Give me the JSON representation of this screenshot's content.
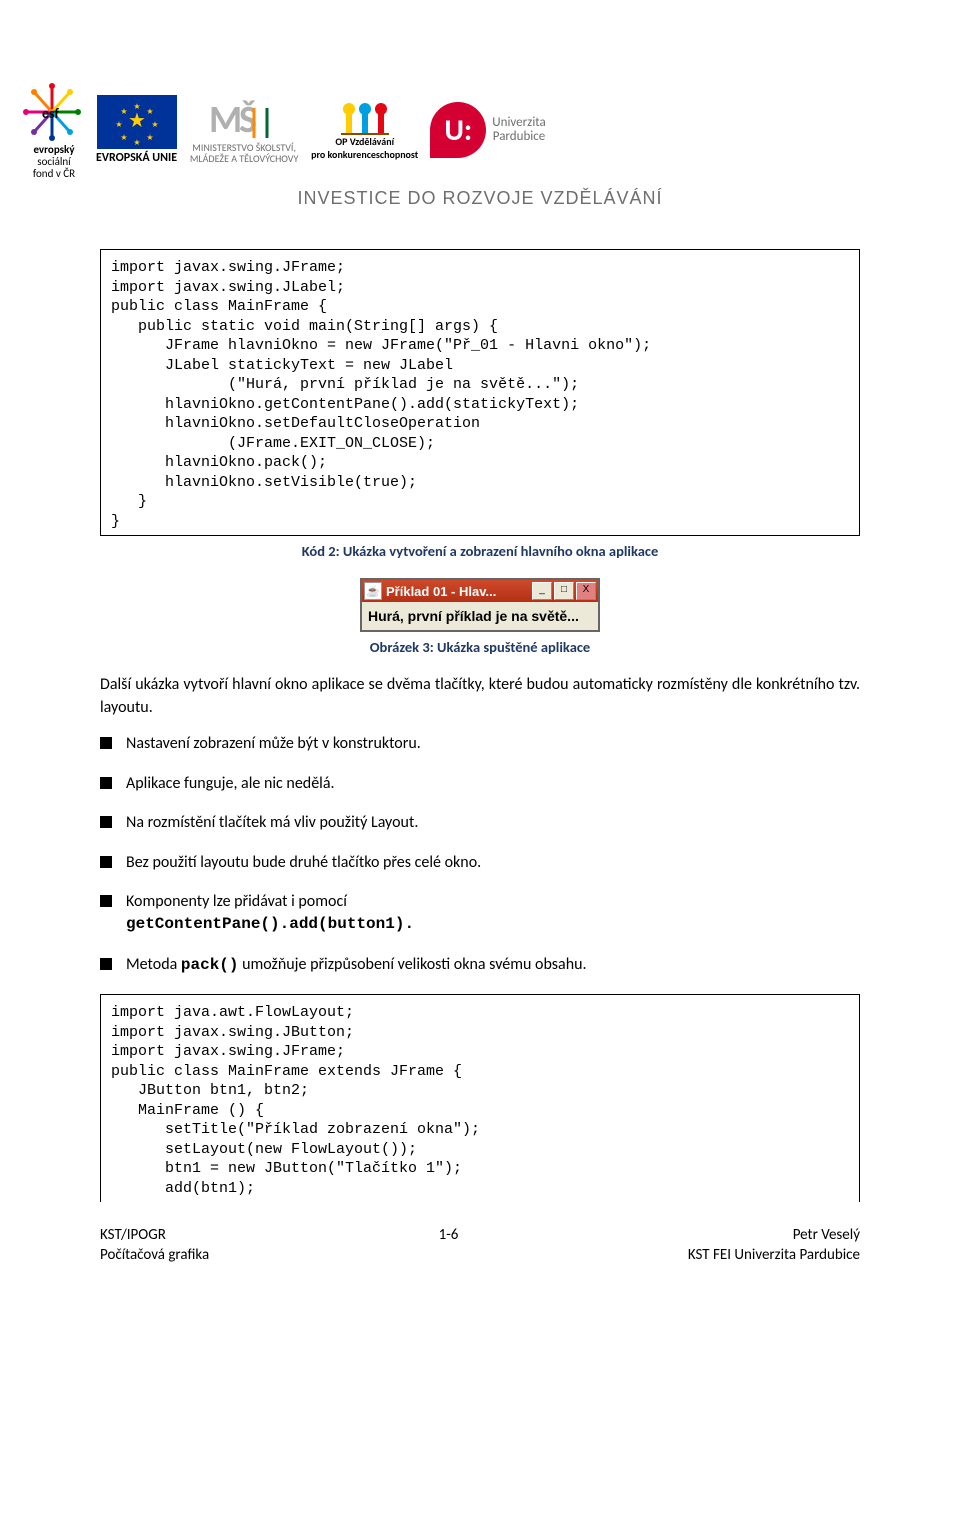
{
  "banner": {
    "esf_text1": "evropský",
    "esf_text2": "sociální",
    "esf_text3": "fond v ČR",
    "eu_label": "EVROPSKÁ UNIE",
    "msmt1": "MINISTERSTVO ŠKOLSTVÍ,",
    "msmt2": "MLÁDEŽE A TĚLOVÝCHOVY",
    "opvzd1": "OP Vzdělávání",
    "opvzd2": "pro konkurenceschopnost",
    "upce1": "Univerzita",
    "upce2": "Pardubice",
    "upce_u": "U:",
    "investice": "INVESTICE DO ROZVOJE VZDĚLÁVÁNÍ",
    "coffee": "☕"
  },
  "code1": "import javax.swing.JFrame;\nimport javax.swing.JLabel;\npublic class MainFrame {\n   public static void main(String[] args) {\n      JFrame hlavniOkno = new JFrame(\"Př_01 - Hlavni okno\");\n      JLabel statickyText = new JLabel\n             (\"Hurá, první příklad je na světě...\");\n      hlavniOkno.getContentPane().add(statickyText);\n      hlavniOkno.setDefaultCloseOperation\n             (JFrame.EXIT_ON_CLOSE);\n      hlavniOkno.pack();\n      hlavniOkno.setVisible(true);\n   }\n}",
  "caption1": "Kód 2: Ukázka vytvoření a zobrazení hlavního okna aplikace",
  "mini_window": {
    "title": "Příklad 01 - Hlav...",
    "body": "Hurá, první příklad je na světě...",
    "min": "_",
    "max": "□",
    "close": "X"
  },
  "caption2": "Obrázek 3: Ukázka spuštěné aplikace",
  "para1": "Další ukázka vytvoří hlavní okno aplikace se dvěma tlačítky, které budou automaticky rozmístěny dle konkrétního tzv. layoutu.",
  "bullets": {
    "b1": "Nastavení zobrazení může být v konstruktoru.",
    "b2": "Aplikace funguje, ale nic nedělá.",
    "b3": "Na rozmístění tlačítek má vliv použitý Layout.",
    "b4": "Bez použití layoutu bude druhé tlačítko přes celé okno.",
    "b5a": "Komponenty lze přidávat i pomocí",
    "b5code": "getContentPane().add(button1).",
    "b6a": "Metoda ",
    "b6code": "pack()",
    "b6b": " umožňuje přizpůsobení velikosti okna svému obsahu."
  },
  "code2": "import java.awt.FlowLayout;\nimport javax.swing.JButton;\nimport javax.swing.JFrame;\npublic class MainFrame extends JFrame {\n   JButton btn1, btn2;\n   MainFrame () {\n      setTitle(\"Příklad zobrazení okna\");\n      setLayout(new FlowLayout());\n      btn1 = new JButton(\"Tlačítko 1\");\n      add(btn1);",
  "footer": {
    "left1": "KST/IPOGR",
    "left2": "Počítačová grafika",
    "center": "1-6",
    "right1": "Petr Veselý",
    "right2": "KST FEI Univerzita Pardubice"
  }
}
